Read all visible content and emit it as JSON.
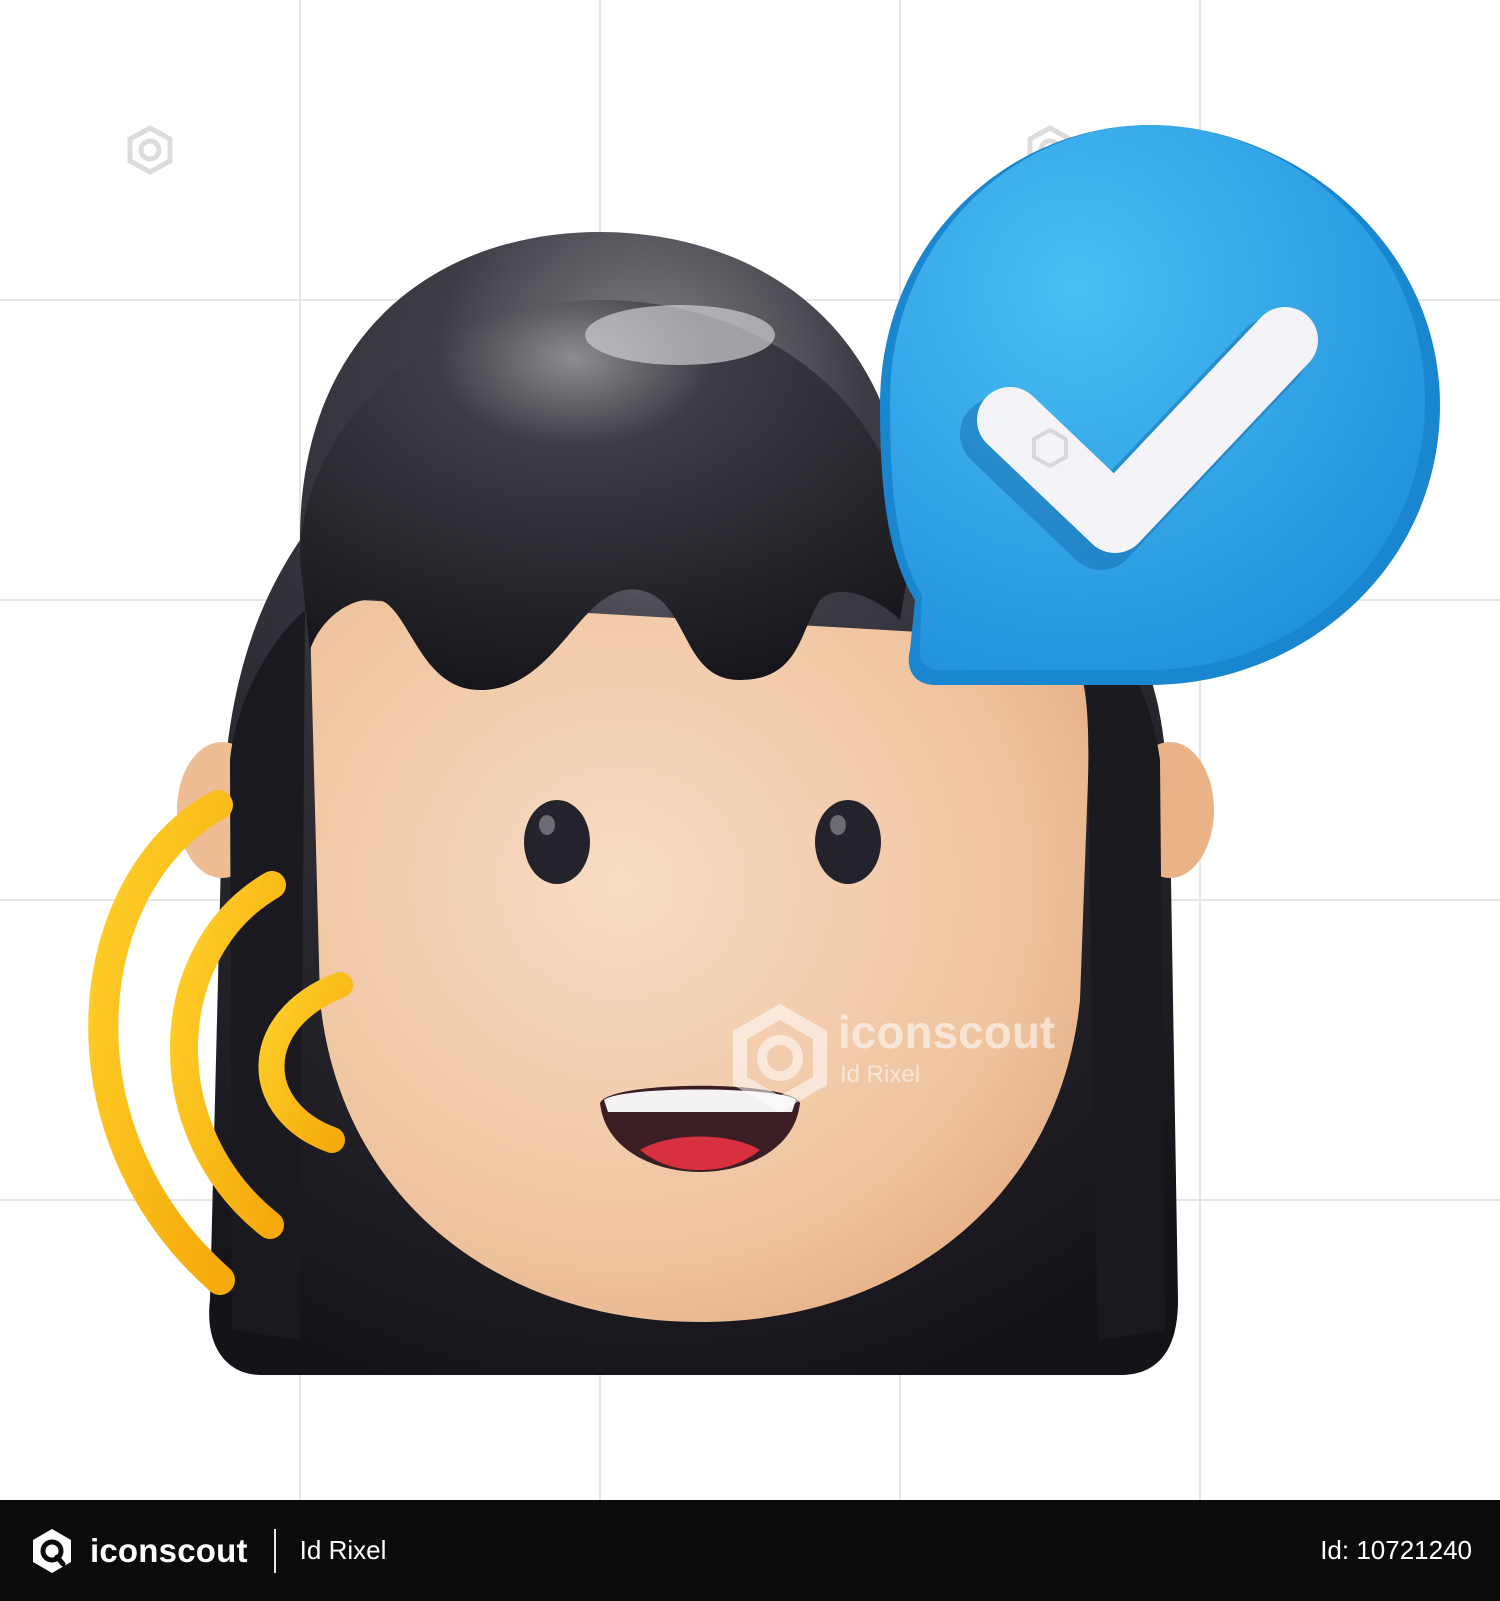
{
  "watermark": {
    "brand": "iconscout",
    "author": "Id Rixel"
  },
  "footer": {
    "brand": "iconscout",
    "author": "Id Rixel",
    "asset_id": "Id: 10721240"
  },
  "colors": {
    "background": "#ffffff",
    "grid": "#e6e6e6",
    "hair": "#1c1b23",
    "skin": "#f1c8a4",
    "bubble": "#2aa0e6",
    "check": "#f4f4f8",
    "sound_waves": "#ffbd14",
    "mouth": "#3a1e24",
    "tongue": "#d8303e",
    "footer": "#0b0b0b"
  },
  "icons": [
    "woman-face-icon",
    "verified-speech-bubble-icon",
    "checkmark-icon",
    "sound-wave-icon",
    "iconscout-logo-icon"
  ]
}
